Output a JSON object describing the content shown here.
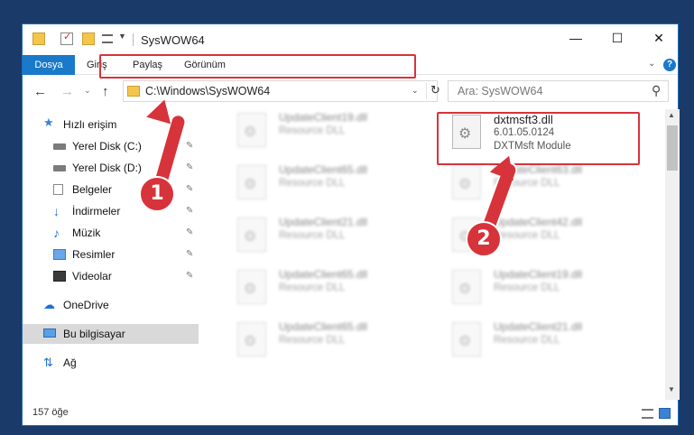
{
  "window": {
    "title": "SysWOW64",
    "buttons": {
      "minimize": "—",
      "maximize": "☐",
      "close": "✕"
    }
  },
  "ribbon": {
    "tabs": [
      {
        "label": "Dosya",
        "active": true
      },
      {
        "label": "Giriş"
      },
      {
        "label": "Paylaş"
      },
      {
        "label": "Görünüm"
      }
    ],
    "help": "?",
    "expand": "⌄"
  },
  "nav": {
    "back": "←",
    "forward": "→",
    "recent": "⌄",
    "up": "↑",
    "address": "C:\\Windows\\SysWOW64",
    "address_dropdown": "⌄",
    "refresh": "↻",
    "search_placeholder": "Ara: SysWOW64",
    "search_icon": "⚲"
  },
  "sidebar": {
    "quick_access": "Hızlı erişim",
    "items": [
      {
        "label": "Yerel Disk (C:)",
        "icon": "disk-icon",
        "pin": "✎"
      },
      {
        "label": "Yerel Disk (D:)",
        "icon": "disk-icon",
        "pin": "✎"
      },
      {
        "label": "Belgeler",
        "icon": "document-icon",
        "pin": "✎"
      },
      {
        "label": "İndirmeler",
        "icon": "download-icon",
        "pin": "✎"
      },
      {
        "label": "Müzik",
        "icon": "music-icon",
        "pin": "✎"
      },
      {
        "label": "Resimler",
        "icon": "pictures-icon",
        "pin": "✎"
      },
      {
        "label": "Videolar",
        "icon": "video-icon",
        "pin": "✎"
      }
    ],
    "onedrive": "OneDrive",
    "this_pc": "Bu bilgisayar",
    "network": "Ağ",
    "icons": {
      "star": "★",
      "download": "↓",
      "music": "♪",
      "cloud": "☁",
      "network": "⇅"
    }
  },
  "files": {
    "highlighted": {
      "name": "dxtmsft3.dll",
      "version": "6.01.05.0124",
      "description": "DXTMsft Module"
    },
    "blurred_left": [
      {
        "name": "UpdateClient19.dll",
        "type": "Resource DLL"
      },
      {
        "name": "UpdateClient65.dll",
        "type": "Resource DLL"
      },
      {
        "name": "UpdateClient21.dll",
        "type": "Resource DLL"
      },
      {
        "name": "UpdateClient65.dll",
        "type": "Resource DLL"
      },
      {
        "name": "UpdateClient65.dll",
        "type": "Resource DLL"
      }
    ],
    "blurred_right": [
      {
        "name": "UpdateClient63.dll",
        "type": "Resource DLL"
      },
      {
        "name": "UpdateClient42.dll",
        "type": "Resource DLL"
      },
      {
        "name": "UpdateClient19.dll",
        "type": "Resource DLL"
      },
      {
        "name": "UpdateClient21.dll",
        "type": "Resource DLL"
      }
    ]
  },
  "scrollbar": {
    "up": "▲",
    "down": "▼"
  },
  "status": {
    "count": "157 öğe"
  },
  "annotations": {
    "step1": "1",
    "step2": "2"
  },
  "colors": {
    "accent": "#1979ca",
    "annotation": "#d7333a",
    "selected": "#d9d9d9"
  }
}
